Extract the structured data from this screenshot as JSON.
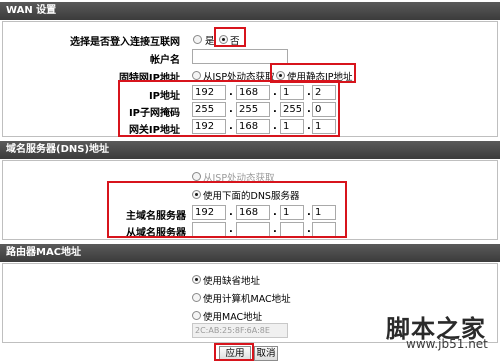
{
  "wan": {
    "title": "WAN 设置",
    "login_label": "选择是否登入连接互联网",
    "login_yes": "是",
    "login_no": "否",
    "account_label": "帐户名",
    "fixed_ip_label": "固特网IP地址",
    "from_isp": "从ISP处动态获取",
    "use_static": "使用静态IP地址",
    "ip_label": "IP地址",
    "ip": [
      "192",
      "168",
      "1",
      "2"
    ],
    "mask_label": "IP子网掩码",
    "mask": [
      "255",
      "255",
      "255",
      "0"
    ],
    "gateway_label": "网关IP地址",
    "gateway": [
      "192",
      "168",
      "1",
      "1"
    ]
  },
  "dns": {
    "title": "域名服务器(DNS)地址",
    "from_isp": "从ISP处动态获取",
    "use_below": "使用下面的DNS服务器",
    "primary_label": "主域名服务器",
    "primary": [
      "192",
      "168",
      "1",
      "1"
    ],
    "secondary_label": "从域名服务器",
    "secondary": [
      "",
      "",
      "",
      ""
    ]
  },
  "mac": {
    "title": "路由器MAC地址",
    "default": "使用缺省地址",
    "computer": "使用计算机MAC地址",
    "custom": "使用MAC地址",
    "mac_value": "2C:AB:25:8F:6A:8E"
  },
  "buttons": {
    "apply": "应用",
    "cancel": "取消"
  },
  "watermark": {
    "brand": "脚本之家",
    "url": "www.jb51.net"
  }
}
